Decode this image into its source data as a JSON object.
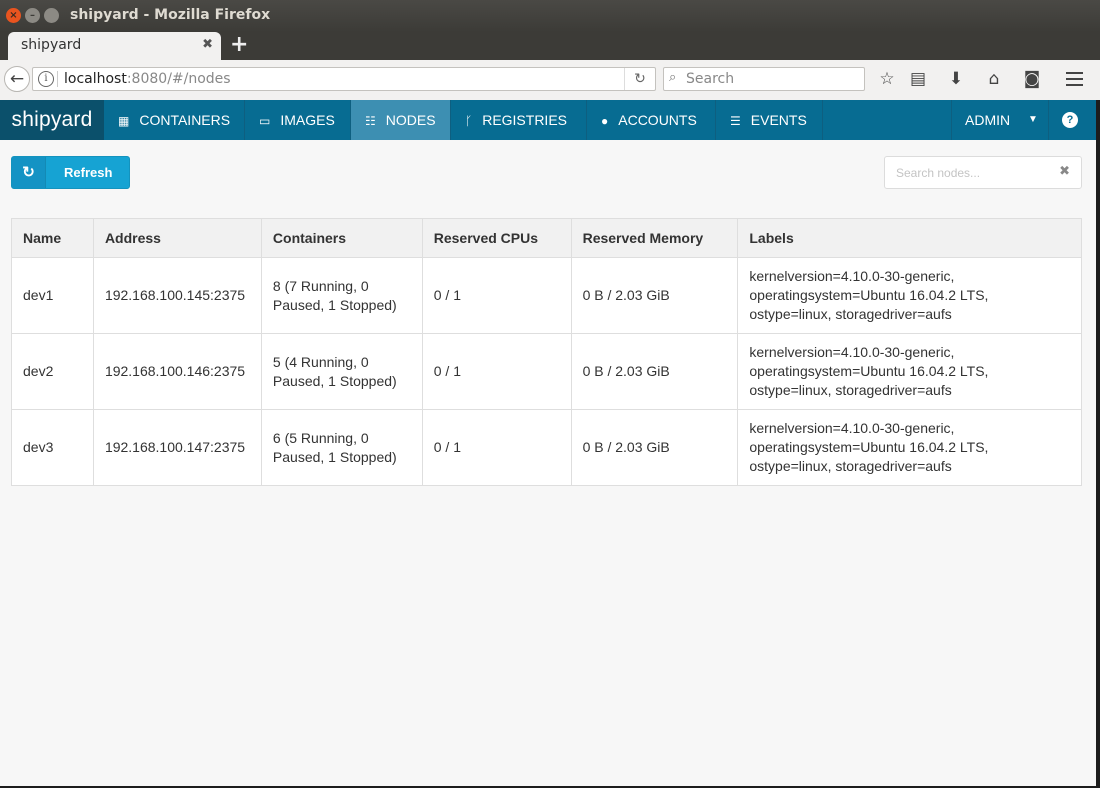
{
  "window": {
    "title": "shipyard - Mozilla Firefox",
    "tab_title": "shipyard",
    "url_host": "localhost",
    "url_path": ":8080/#/nodes",
    "search_placeholder": "Search"
  },
  "app": {
    "brand": "shipyard",
    "menu": [
      {
        "label": "CONTAINERS",
        "icon": "grid-icon"
      },
      {
        "label": "IMAGES",
        "icon": "drive-icon"
      },
      {
        "label": "NODES",
        "icon": "sitemap-icon",
        "active": true
      },
      {
        "label": "REGISTRIES",
        "icon": "fork-icon"
      },
      {
        "label": "ACCOUNTS",
        "icon": "user-icon"
      },
      {
        "label": "EVENTS",
        "icon": "list-icon"
      }
    ],
    "user_menu": "ADMIN",
    "help": "?"
  },
  "toolbar": {
    "refresh_label": "Refresh",
    "search_placeholder": "Search nodes..."
  },
  "table": {
    "headers": [
      "Name",
      "Address",
      "Containers",
      "Reserved CPUs",
      "Reserved Memory",
      "Labels"
    ],
    "rows": [
      {
        "name": "dev1",
        "address": "192.168.100.145:2375",
        "containers": "8 (7 Running, 0 Paused, 1 Stopped)",
        "cpus": "0 / 1",
        "memory": "0 B / 2.03 GiB",
        "labels": "kernelversion=4.10.0-30-generic, operatingsystem=Ubuntu 16.04.2 LTS, ostype=linux, storagedriver=aufs"
      },
      {
        "name": "dev2",
        "address": "192.168.100.146:2375",
        "containers": "5 (4 Running, 0 Paused, 1 Stopped)",
        "cpus": "0 / 1",
        "memory": "0 B / 2.03 GiB",
        "labels": "kernelversion=4.10.0-30-generic, operatingsystem=Ubuntu 16.04.2 LTS, ostype=linux, storagedriver=aufs"
      },
      {
        "name": "dev3",
        "address": "192.168.100.147:2375",
        "containers": "6 (5 Running, 0 Paused, 1 Stopped)",
        "cpus": "0 / 1",
        "memory": "0 B / 2.03 GiB",
        "labels": "kernelversion=4.10.0-30-generic, operatingsystem=Ubuntu 16.04.2 LTS, ostype=linux, storagedriver=aufs"
      }
    ]
  }
}
